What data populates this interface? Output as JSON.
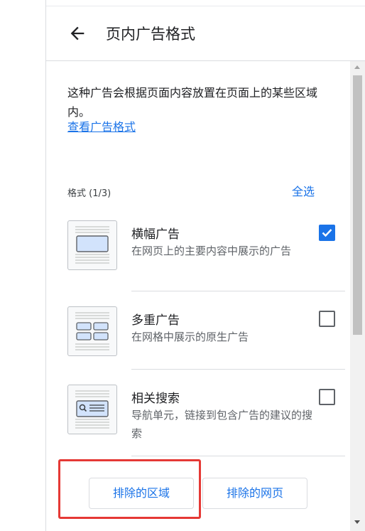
{
  "header": {
    "title": "页内广告格式"
  },
  "intro": {
    "description": "这种广告会根据页面内容放置在页面上的某些区域内。",
    "link_label": "查看广告格式"
  },
  "formats": {
    "label": "格式 (1/3)",
    "select_all_label": "全选",
    "items": [
      {
        "title": "横幅广告",
        "description": "在网页上的主要内容中展示的广告",
        "checked": true
      },
      {
        "title": "多重广告",
        "description": "在网格中展示的原生广告",
        "checked": false
      },
      {
        "title": "相关搜索",
        "description": "导航单元，链接到包含广告的建议的搜索",
        "checked": false
      }
    ]
  },
  "buttons": {
    "excluded_areas_label": "排除的区域",
    "excluded_pages_label": "排除的网页"
  },
  "colors": {
    "accent": "#1a73e8",
    "highlight": "#e53935"
  }
}
